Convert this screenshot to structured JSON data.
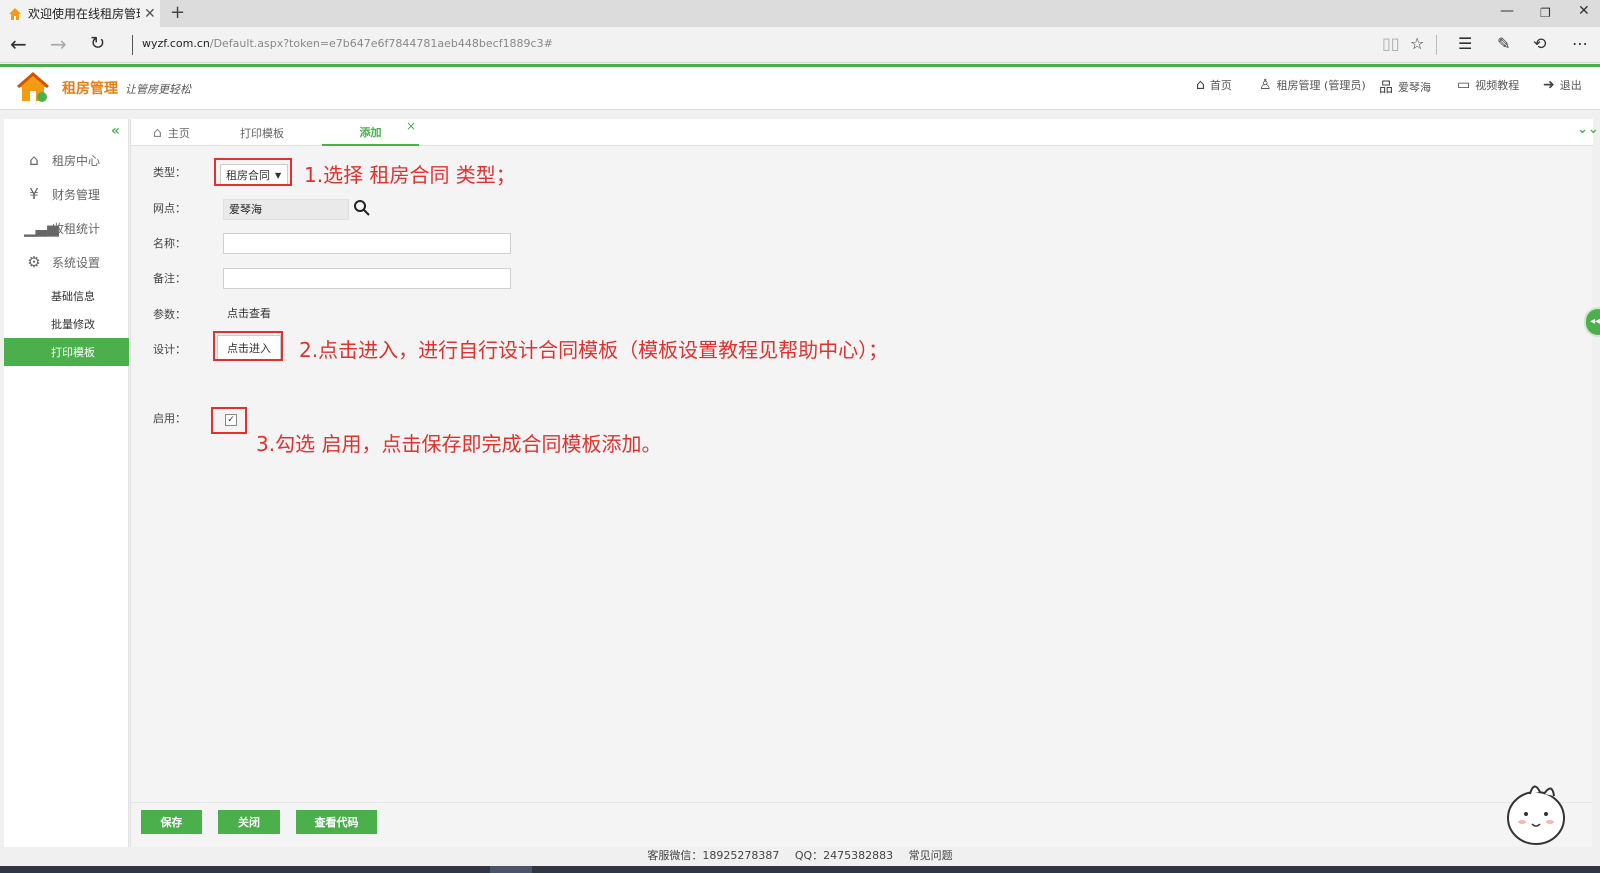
{
  "browser": {
    "tab_title": "欢迎使用在线租房管理",
    "tab_close": "✕",
    "new_tab": "+",
    "url_host": "wyzf.com.cn",
    "url_path": "/Default.aspx?token=e7b647e6f7844781aeb448becf1889c3#"
  },
  "header": {
    "brand": "租房管理",
    "slogan": "让管房更轻松",
    "nav": {
      "home": "首页",
      "user": "租房管理 (管理员)",
      "branch": "爱琴海",
      "video": "视频教程",
      "exit": "退出"
    }
  },
  "sidebar": {
    "items": [
      {
        "label": "租房中心",
        "icon": "home-icon"
      },
      {
        "label": "财务管理",
        "icon": "finance-icon"
      },
      {
        "label": "收租统计",
        "icon": "chart-icon"
      },
      {
        "label": "系统设置",
        "icon": "gear-icon"
      }
    ],
    "sub_items": [
      {
        "label": "基础信息"
      },
      {
        "label": "批量修改"
      },
      {
        "label": "打印模板"
      }
    ],
    "active_sub": "打印模板"
  },
  "page_tabs": {
    "home": "主页",
    "print_template": "打印模板",
    "add": "添加",
    "close": "×"
  },
  "form": {
    "type_label": "类型：",
    "type_value": "租房合同",
    "branch_label": "网点：",
    "branch_value": "爱琴海",
    "name_label": "名称：",
    "name_value": "",
    "remark_label": "备注：",
    "remark_value": "",
    "params_label": "参数：",
    "params_link": "点击查看",
    "design_label": "设计：",
    "design_button": "点击进入",
    "enable_label": "启用：",
    "enable_checked": true
  },
  "annotations": {
    "step1": "1.选择 租房合同 类型；",
    "step2": "2.点击进入，进行自行设计合同模板（模板设置教程见帮助中心）；",
    "step3": "3.勾选 启用，点击保存即完成合同模板添加。"
  },
  "footer_buttons": {
    "save": "保存",
    "close": "关闭",
    "view_code": "查看代码"
  },
  "bottom_bar": {
    "wechat": "客服微信：18925278387",
    "qq": "QQ：2475382883",
    "faq": "常见问题"
  },
  "colors": {
    "accent_green": "#4bb04b",
    "brand_orange": "#e67e16",
    "annotation_red": "#e0312f"
  }
}
